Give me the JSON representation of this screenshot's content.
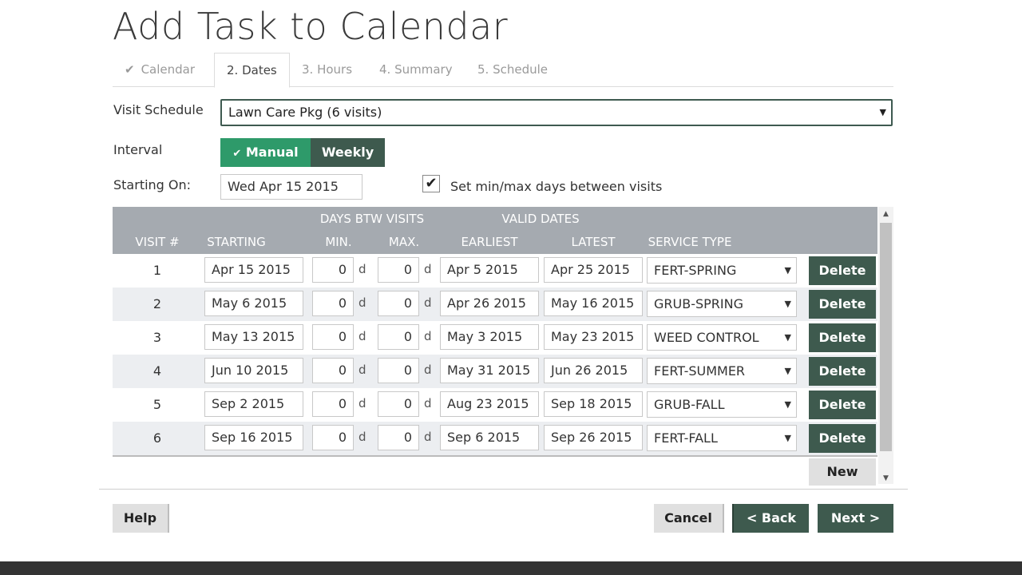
{
  "page_title": "Add Task to Calendar",
  "tabs": [
    {
      "label": "Calendar",
      "done": true
    },
    {
      "label": "2. Dates",
      "active": true
    },
    {
      "label": "3. Hours"
    },
    {
      "label": "4. Summary"
    },
    {
      "label": "5. Schedule"
    }
  ],
  "form": {
    "visit_schedule_label": "Visit Schedule",
    "visit_schedule_value": "Lawn Care Pkg (6 visits)",
    "interval_label": "Interval",
    "interval_manual": "Manual",
    "interval_weekly": "Weekly",
    "starting_on_label": "Starting On:",
    "starting_on_value": "Wed Apr 15 2015",
    "minmax_checkbox_label": "Set min/max days between visits",
    "minmax_checked": true
  },
  "grid": {
    "group_headers": {
      "days_btw": "DAYS BTW VISITS",
      "valid_dates": "VALID DATES"
    },
    "columns": {
      "visit": "VISIT #",
      "starting": "STARTING",
      "min": "MIN.",
      "max": "MAX.",
      "earliest": "EARLIEST",
      "latest": "LATEST",
      "service_type": "SERVICE TYPE"
    },
    "day_unit": "d",
    "delete_label": "Delete",
    "new_label": "New",
    "rows": [
      {
        "visit": "1",
        "starting": "Apr 15 2015",
        "min": "0",
        "max": "0",
        "earliest": "Apr 5 2015",
        "latest": "Apr 25 2015",
        "service": "FERT-SPRING"
      },
      {
        "visit": "2",
        "starting": "May 6 2015",
        "min": "0",
        "max": "0",
        "earliest": "Apr 26 2015",
        "latest": "May 16 2015",
        "service": "GRUB-SPRING"
      },
      {
        "visit": "3",
        "starting": "May 13 2015",
        "min": "0",
        "max": "0",
        "earliest": "May 3 2015",
        "latest": "May 23 2015",
        "service": "WEED CONTROL"
      },
      {
        "visit": "4",
        "starting": "Jun 10 2015",
        "min": "0",
        "max": "0",
        "earliest": "May 31 2015",
        "latest": "Jun 26 2015",
        "service": "FERT-SUMMER"
      },
      {
        "visit": "5",
        "starting": "Sep 2 2015",
        "min": "0",
        "max": "0",
        "earliest": "Aug 23 2015",
        "latest": "Sep 18 2015",
        "service": "GRUB-FALL"
      },
      {
        "visit": "6",
        "starting": "Sep 16 2015",
        "min": "0",
        "max": "0",
        "earliest": "Sep 6 2015",
        "latest": "Sep 26 2015",
        "service": "FERT-FALL"
      }
    ]
  },
  "buttons": {
    "help": "Help",
    "cancel": "Cancel",
    "back": "< Back",
    "next": "Next >"
  },
  "colors": {
    "primary_dark": "#3e5a4e",
    "accent_green": "#2e9a6a",
    "header_gray": "#a5aab0"
  }
}
